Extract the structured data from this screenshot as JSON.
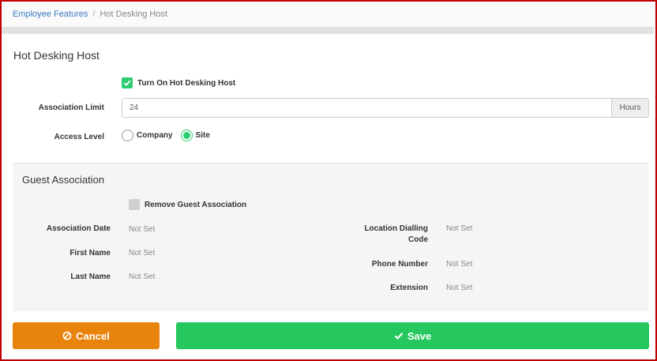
{
  "breadcrumb": {
    "parent": "Employee Features",
    "separator": "/",
    "current": "Hot Desking Host"
  },
  "page": {
    "title": "Hot Desking Host"
  },
  "hot_desking": {
    "toggle_label": "Turn On Hot Desking Host",
    "toggle_checked": true,
    "association_limit_label": "Association Limit",
    "association_limit_value": "24",
    "association_limit_unit": "Hours",
    "access_level_label": "Access Level",
    "access_level_options": [
      "Company",
      "Site"
    ],
    "access_level_selected": "Site"
  },
  "guest": {
    "title": "Guest Association",
    "remove_label": "Remove Guest Association",
    "remove_checked": false,
    "association_date_label": "Association Date",
    "association_date_value": "Not Set",
    "first_name_label": "First Name",
    "first_name_value": "Not Set",
    "last_name_label": "Last Name",
    "last_name_value": "Not Set",
    "location_dialling_code_label_1": "Location Dialling",
    "location_dialling_code_label_2": "Code",
    "location_dialling_code_value": "Not Set",
    "phone_number_label": "Phone Number",
    "phone_number_value": "Not Set",
    "extension_label": "Extension",
    "extension_value": "Not Set"
  },
  "actions": {
    "cancel_label": "Cancel",
    "save_label": "Save",
    "cancel_icon": "ban-icon",
    "save_icon": "check-icon"
  },
  "colors": {
    "accent_green": "#26c75e",
    "cancel_orange": "#e8830c",
    "link_blue": "#3b7ac2",
    "frame_red": "#c00000"
  }
}
